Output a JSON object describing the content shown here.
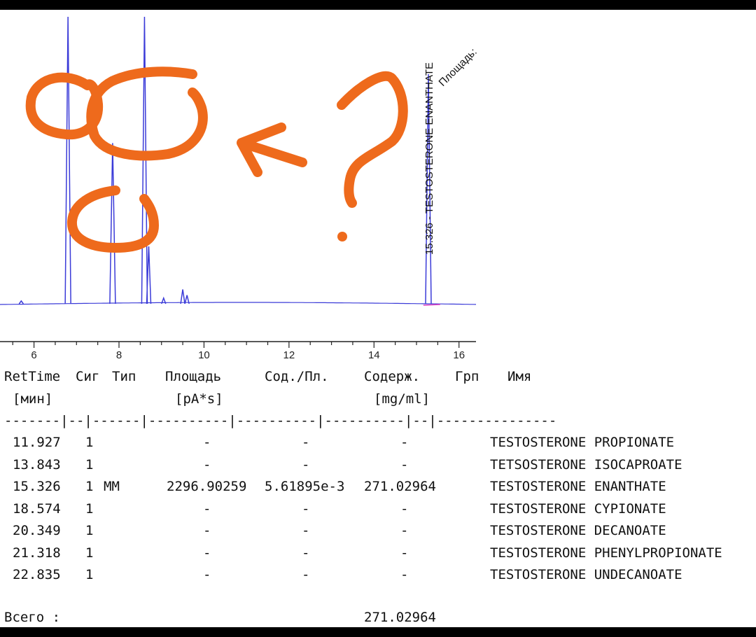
{
  "chart_data": {
    "type": "line",
    "title": "",
    "xlabel": "",
    "ylabel": "",
    "xlim": [
      5.2,
      16.4
    ],
    "xticks": [
      6,
      8,
      10,
      12,
      14,
      16
    ],
    "series_color": "#3b3bd8",
    "baseline_color": "#e040c0",
    "peaks": [
      {
        "rt": 5.7,
        "height": 0.01
      },
      {
        "rt": 6.8,
        "height": 1.0
      },
      {
        "rt": 7.85,
        "height": 0.56
      },
      {
        "rt": 8.6,
        "height": 1.0
      },
      {
        "rt": 8.7,
        "height": 0.2
      },
      {
        "rt": 9.05,
        "height": 0.02
      },
      {
        "rt": 9.5,
        "height": 0.05
      },
      {
        "rt": 9.6,
        "height": 0.03
      },
      {
        "rt": 15.28,
        "height": 0.8
      }
    ],
    "peak_labels": [
      {
        "rt": 15.326,
        "text": "15.326 - TESTOSTERONE ENANTHATE"
      }
    ],
    "area_label": "Площадь:"
  },
  "table": {
    "headers": [
      "RetTime",
      "Сиг",
      "Тип",
      "Площадь",
      "Сод./Пл.",
      "Содерж.",
      "Грп",
      "Имя"
    ],
    "units": {
      "ret": "[мин]",
      "area": "[pA*s]",
      "conc": "[mg/ml]"
    },
    "rule": "-------|--|------|----------|----------|----------|--|---------------",
    "rows": [
      {
        "ret": "11.927",
        "sig": "1",
        "type": "",
        "area": "-",
        "ratio": "-",
        "conc": "-",
        "name": "TESTOSTERONE PROPIONATE"
      },
      {
        "ret": "13.843",
        "sig": "1",
        "type": "",
        "area": "-",
        "ratio": "-",
        "conc": "-",
        "name": "TETSOSTERONE ISOCAPROATE"
      },
      {
        "ret": "15.326",
        "sig": "1",
        "type": "MM",
        "area": "2296.90259",
        "ratio": "5.61895e-3",
        "conc": "271.02964",
        "name": "TESTOSTERONE ENANTHATE"
      },
      {
        "ret": "18.574",
        "sig": "1",
        "type": "",
        "area": "-",
        "ratio": "-",
        "conc": "-",
        "name": "TESTOSTERONE CYPIONATE"
      },
      {
        "ret": "20.349",
        "sig": "1",
        "type": "",
        "area": "-",
        "ratio": "-",
        "conc": "-",
        "name": "TESTOSTERONE DECANOATE"
      },
      {
        "ret": "21.318",
        "sig": "1",
        "type": "",
        "area": "-",
        "ratio": "-",
        "conc": "-",
        "name": "TESTOSTERONE PHENYLPROPIONATE"
      },
      {
        "ret": "22.835",
        "sig": "1",
        "type": "",
        "area": "-",
        "ratio": "-",
        "conc": "-",
        "name": "TESTOSTERONE UNDECANOATE"
      }
    ],
    "total_label": "Всего :",
    "total_value": "271.02964"
  },
  "annotation": {
    "color": "#ee6a1c"
  }
}
